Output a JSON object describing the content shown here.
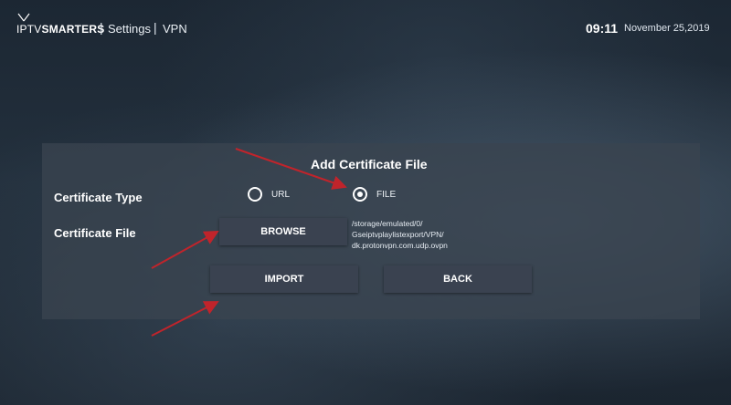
{
  "header": {
    "logo_left": "IPTV",
    "logo_right": "SMARTERS",
    "separator": "|",
    "breadcrumb": [
      "Settings",
      "VPN"
    ],
    "time": "09:11",
    "date": "November 25,2019"
  },
  "dialog": {
    "title": "Add Certificate File",
    "certificate_type_label": "Certificate Type",
    "certificate_file_label": "Certificate File",
    "options": [
      {
        "label": "URL",
        "selected": false
      },
      {
        "label": "FILE",
        "selected": true
      }
    ],
    "browse_label": "BROWSE",
    "file_path_lines": [
      "/storage/emulated/0/",
      "Gseiptvplaylistexport/VPN/",
      "dk.protonvpn.com.udp.ovpn"
    ],
    "import_label": "IMPORT",
    "back_label": "BACK"
  },
  "colors": {
    "annotation_arrow": "#c0242b",
    "button_bg": "#3a4250",
    "panel_bg": "#3a4450"
  }
}
